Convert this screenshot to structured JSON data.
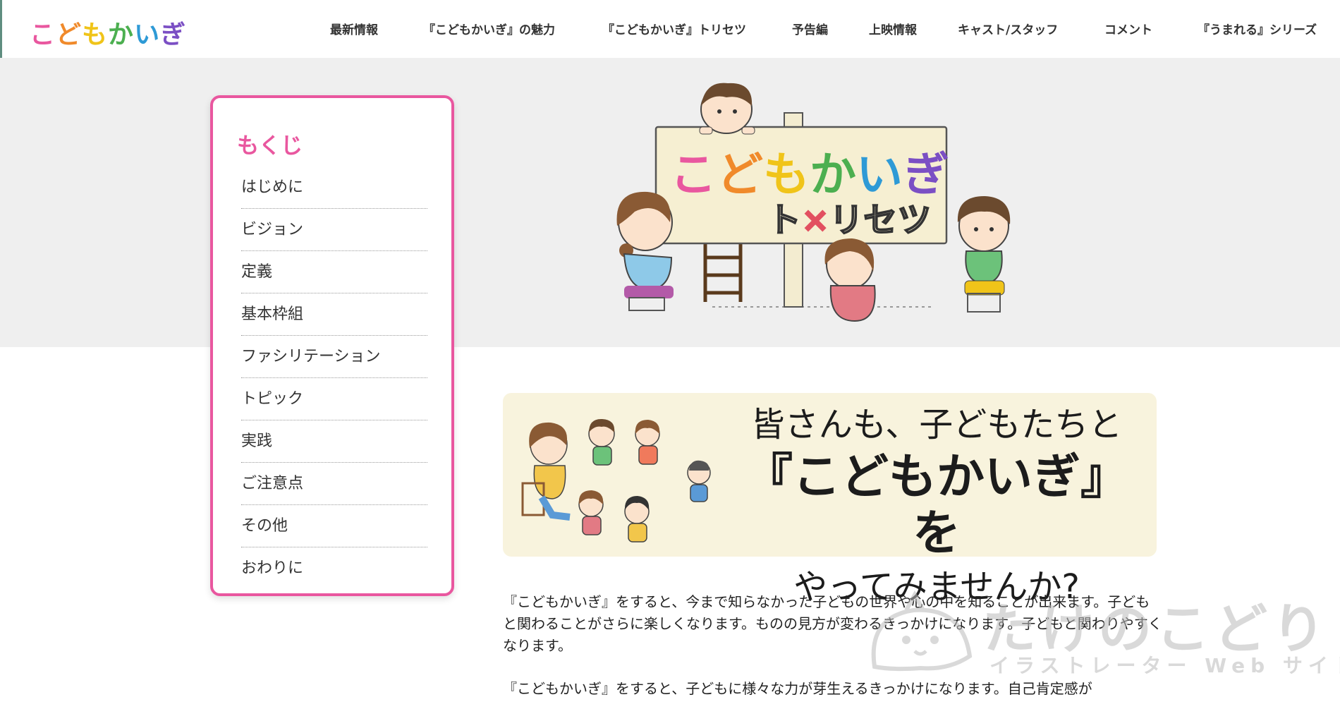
{
  "header": {
    "logo_chars": [
      "こ",
      "ど",
      "も",
      "か",
      "い",
      "ぎ"
    ],
    "logo_colors": [
      "#e9579f",
      "#f08a2b",
      "#f0c419",
      "#4caf50",
      "#2e9ad6",
      "#7b4fc4"
    ],
    "nav": [
      "最新情報",
      "『こどもかいぎ』の魅力",
      "『こどもかいぎ』トリセツ",
      "予告編",
      "上映情報",
      "キャスト/スタッフ",
      "コメント",
      "『うまれる』シリーズ"
    ]
  },
  "hero": {
    "sign_title_chars": [
      "こ",
      "ど",
      "も",
      "か",
      "い",
      "ぎ"
    ],
    "sign_title_colors": [
      "#e9579f",
      "#f08a2b",
      "#f0c419",
      "#4caf50",
      "#2e9ad6",
      "#7b4fc4"
    ],
    "sign_sub_before": "ト",
    "sign_sub_cross": "×",
    "sign_sub_after": "リセツ"
  },
  "toc": {
    "title": "もくじ",
    "items": [
      "はじめに",
      "ビジョン",
      "定義",
      "基本枠組",
      "ファシリテーション",
      "トピック",
      "実践",
      "ご注意点",
      "その他",
      "おわりに"
    ]
  },
  "banner": {
    "line1": "皆さんも、子どもたちと",
    "line2": "『こどもかいぎ』を",
    "line3": "やってみませんか?"
  },
  "body": {
    "paragraph1": "『こどもかいぎ』をすると、今まで知らなかった子どもの世界や心の中を知ることが出来ます。子どもと関わることがさらに楽しくなります。ものの見方が変わるきっかけになります。子どもと関わりやすくなります。",
    "paragraph2": "『こどもかいぎ』をすると、子どもに様々な力が芽生えるきっかけになります。自己肯定感が"
  },
  "watermark": {
    "title": "たけのこどり",
    "subtitle": "イラストレーター Web サイト"
  }
}
